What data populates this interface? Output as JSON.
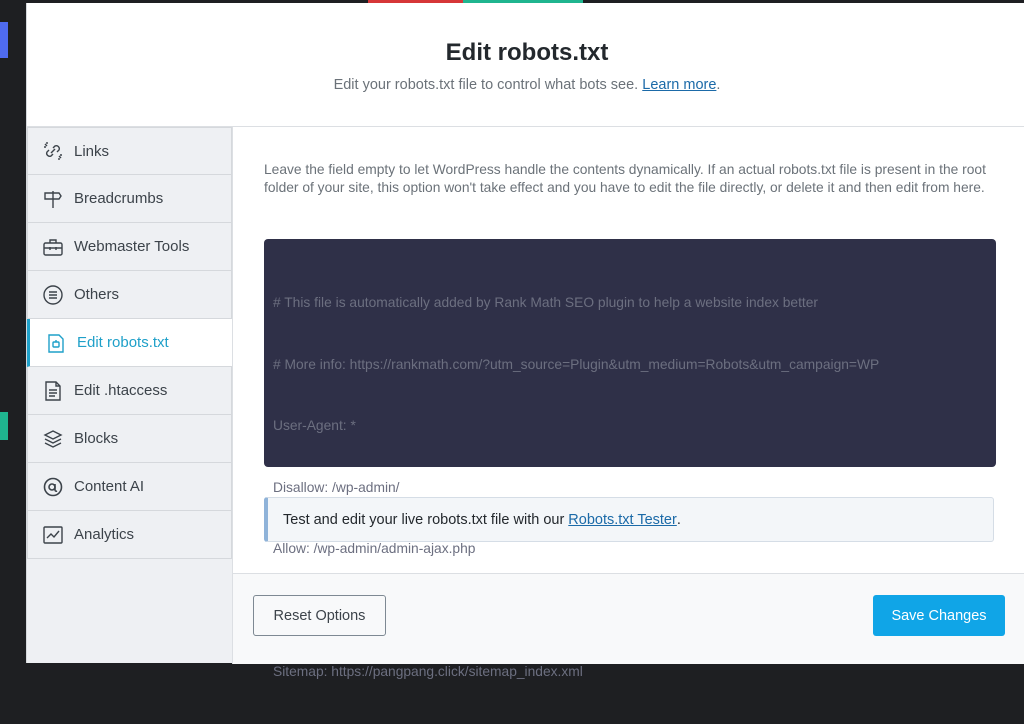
{
  "header": {
    "title": "Edit robots.txt",
    "subtitle": "Edit your robots.txt file to control what bots see.",
    "learn_more": "Learn more",
    "subtitle_end": "."
  },
  "sidebar": {
    "items": [
      {
        "label": "Links",
        "icon": "links-icon"
      },
      {
        "label": "Breadcrumbs",
        "icon": "signpost-icon"
      },
      {
        "label": "Webmaster Tools",
        "icon": "toolbox-icon"
      },
      {
        "label": "Others",
        "icon": "list-circle-icon"
      },
      {
        "label": "Edit robots.txt",
        "icon": "robot-file-icon",
        "active": true
      },
      {
        "label": "Edit .htaccess",
        "icon": "document-icon"
      },
      {
        "label": "Blocks",
        "icon": "blocks-icon"
      },
      {
        "label": "Content AI",
        "icon": "content-ai-icon"
      },
      {
        "label": "Analytics",
        "icon": "analytics-icon"
      }
    ]
  },
  "main": {
    "description": "Leave the field empty to let WordPress handle the contents dynamically. If an actual robots.txt file is present in the root folder of your site, this option won't take effect and you have to edit the file directly, or delete it and then edit from here.",
    "robots_lines": [
      "# This file is automatically added by Rank Math SEO plugin to help a website index better",
      "# More info: https://rankmath.com/?utm_source=Plugin&utm_medium=Robots&utm_campaign=WP",
      "User-Agent: *",
      "Disallow: /wp-admin/",
      "Allow: /wp-admin/admin-ajax.php",
      "",
      "Sitemap: https://pangpang.click/sitemap_index.xml"
    ],
    "notice_text": "Test and edit your live robots.txt file with our",
    "notice_link": "Robots.txt Tester",
    "notice_end": "."
  },
  "footer": {
    "reset_label": "Reset Options",
    "save_label": "Save Changes"
  },
  "colors": {
    "accent": "#1fa0c9",
    "save_button": "#10a5e7",
    "editor_bg": "#2f3048"
  }
}
